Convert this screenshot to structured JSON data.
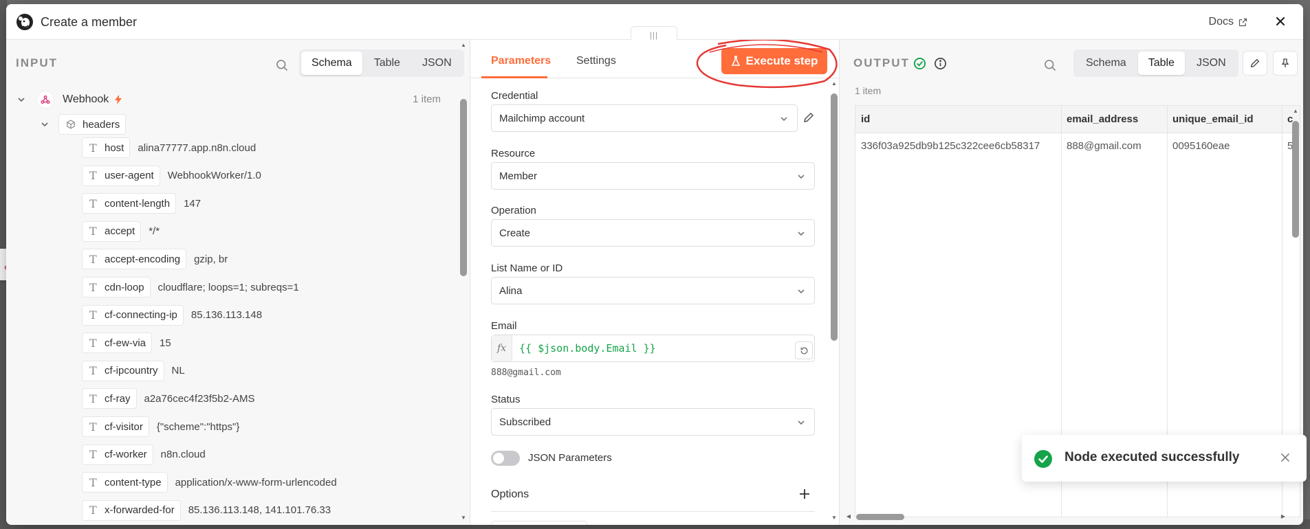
{
  "header": {
    "title": "Create a member",
    "docs_label": "Docs"
  },
  "input": {
    "title": "INPUT",
    "view_tabs": [
      "Schema",
      "Table",
      "JSON"
    ],
    "active_view": "Schema",
    "node_name": "Webhook",
    "item_count": "1 item",
    "group_name": "headers",
    "fields": [
      {
        "key": "host",
        "value": "alina77777.app.n8n.cloud"
      },
      {
        "key": "user-agent",
        "value": "WebhookWorker/1.0"
      },
      {
        "key": "content-length",
        "value": "147"
      },
      {
        "key": "accept",
        "value": "*/*"
      },
      {
        "key": "accept-encoding",
        "value": "gzip, br"
      },
      {
        "key": "cdn-loop",
        "value": "cloudflare; loops=1; subreqs=1"
      },
      {
        "key": "cf-connecting-ip",
        "value": "85.136.113.148"
      },
      {
        "key": "cf-ew-via",
        "value": "15"
      },
      {
        "key": "cf-ipcountry",
        "value": "NL"
      },
      {
        "key": "cf-ray",
        "value": "a2a76cec4f23f5b2-AMS"
      },
      {
        "key": "cf-visitor",
        "value": "{\"scheme\":\"https\"}"
      },
      {
        "key": "cf-worker",
        "value": "n8n.cloud"
      },
      {
        "key": "content-type",
        "value": "application/x-www-form-urlencoded"
      },
      {
        "key": "x-forwarded-for",
        "value": "85.136.113.148, 141.101.76.33"
      }
    ]
  },
  "params": {
    "tabs": [
      "Parameters",
      "Settings"
    ],
    "active_tab": "Parameters",
    "execute_label": "Execute step",
    "credential_label": "Credential",
    "credential_value": "Mailchimp account",
    "resource_label": "Resource",
    "resource_value": "Member",
    "operation_label": "Operation",
    "operation_value": "Create",
    "list_label": "List Name or ID",
    "list_value": "Alina",
    "email_label": "Email",
    "email_expression": "{{ $json.body.Email }}",
    "email_fx": "fx",
    "email_preview": "888@gmail.com",
    "status_label": "Status",
    "status_value": "Subscribed",
    "json_params_label": "JSON Parameters",
    "json_params_on": false,
    "options_label": "Options"
  },
  "output": {
    "title": "OUTPUT",
    "view_tabs": [
      "Schema",
      "Table",
      "JSON"
    ],
    "active_view": "Table",
    "item_count": "1 item",
    "columns": [
      "id",
      "email_address",
      "unique_email_id",
      "c"
    ],
    "rows": [
      [
        "336f03a925db9b125c322cee6cb58317",
        "888@gmail.com",
        "0095160eae",
        "5"
      ]
    ]
  },
  "toast": {
    "message": "Node executed successfully"
  },
  "colors": {
    "accent": "#ff6d3b",
    "success": "#16a34a",
    "expression": "#16a34a",
    "annotation": "#e53935",
    "webhook": "#e0357a"
  },
  "icons": [
    "mailchimp-logo-icon",
    "external-link-icon",
    "close-icon",
    "search-icon",
    "webhook-icon",
    "lightning-icon",
    "cube-icon",
    "chevron-down-icon",
    "text-type-icon",
    "flask-icon",
    "pencil-icon",
    "pin-icon",
    "check-circle-icon",
    "info-icon",
    "plus-icon",
    "reset-icon"
  ]
}
